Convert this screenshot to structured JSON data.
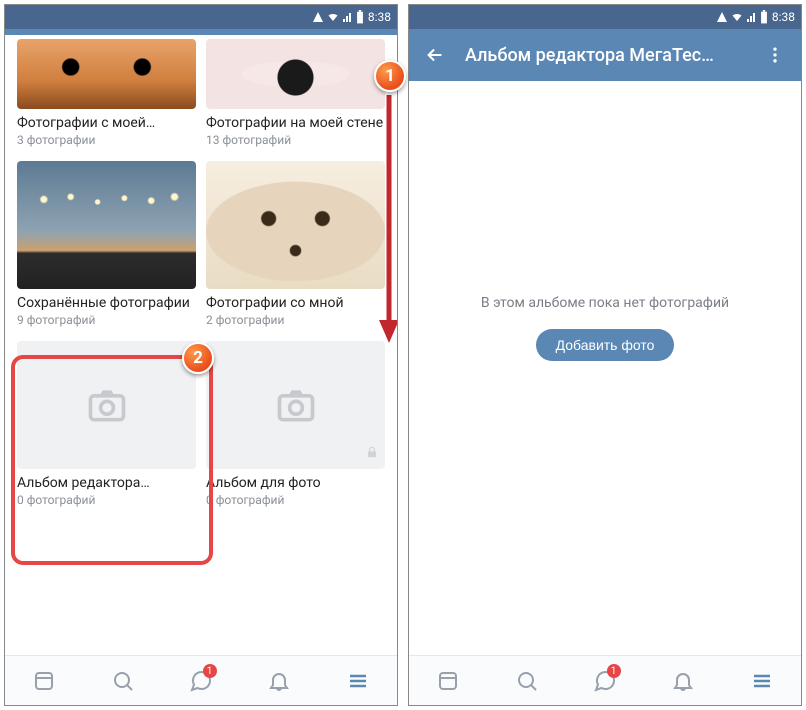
{
  "status": {
    "time": "8:38"
  },
  "left": {
    "albums": [
      {
        "title": "Фотографии с моей…",
        "count": "3 фотографии"
      },
      {
        "title": "Фотографии на моей стене",
        "count": "13 фотографий"
      },
      {
        "title": "Сохранённые фотографии",
        "count": "9 фотографий"
      },
      {
        "title": "Фотографии со мной",
        "count": "2 фотографии"
      },
      {
        "title": "Альбом редактора…",
        "count": "0 фотографий"
      },
      {
        "title": "Альбом для фото",
        "count": "0 фотографий"
      }
    ],
    "nav_badge": "1"
  },
  "right": {
    "header_title": "Альбом редактора МегаТес…",
    "empty_text": "В этом альбоме пока нет фотографий",
    "add_button": "Добавить фото",
    "nav_badge": "1"
  },
  "markers": {
    "one": "1",
    "two": "2"
  }
}
